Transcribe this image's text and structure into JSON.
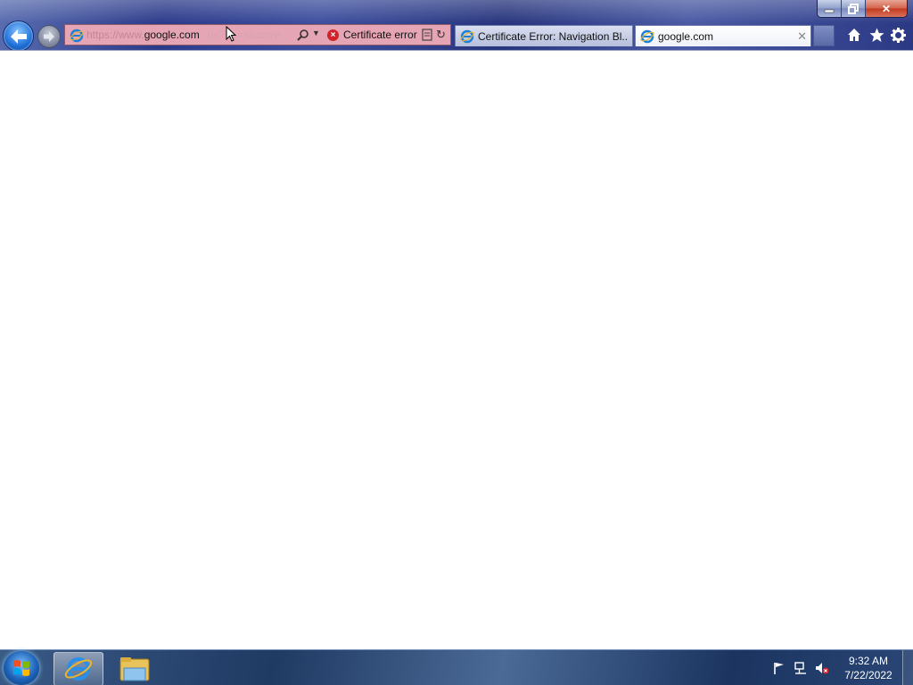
{
  "window": {
    "minimize_label": "",
    "maximize_label": "",
    "close_label": "✕"
  },
  "addressbar": {
    "url_prefix": "https://www.",
    "url_host": "google.com",
    "url_tail": "url?sa=s&dmre",
    "cert_status": "Certificate error",
    "status_color": "#e6a5b5"
  },
  "tabs": [
    {
      "label": "Certificate Error: Navigation Bl...",
      "active": false,
      "icon": "ie-icon"
    },
    {
      "label": "google.com",
      "active": true,
      "icon": "ie-icon",
      "close": "✕"
    }
  ],
  "toolbar": {
    "home_icon": "home-icon",
    "favorites_icon": "star-icon",
    "tools_icon": "gear-icon"
  },
  "taskbar": {
    "start": "windows-orb",
    "apps": [
      {
        "name": "internet-explorer",
        "active": true
      },
      {
        "name": "windows-explorer",
        "active": false
      }
    ],
    "clock": {
      "time": "9:32 AM",
      "date": "7/22/2022"
    },
    "tray": [
      "action-center-flag",
      "network",
      "volume-muted"
    ]
  }
}
